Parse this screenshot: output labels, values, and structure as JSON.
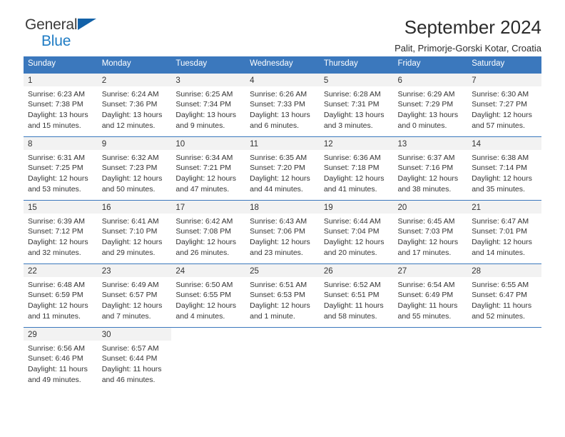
{
  "brand": {
    "word_one": "General",
    "word_two": "Blue",
    "accent_color": "#1261a8",
    "blue_text_color": "#1f7cc4"
  },
  "header": {
    "title": "September 2024",
    "subtitle": "Palit, Primorje-Gorski Kotar, Croatia",
    "header_bg_color": "#3b78bd",
    "daynum_bg_color": "#f2f2f2"
  },
  "weekday_headers": [
    "Sunday",
    "Monday",
    "Tuesday",
    "Wednesday",
    "Thursday",
    "Friday",
    "Saturday"
  ],
  "weeks": [
    [
      {
        "day": "1",
        "sunrise": "Sunrise: 6:23 AM",
        "sunset": "Sunset: 7:38 PM",
        "daylight": "Daylight: 13 hours and 15 minutes."
      },
      {
        "day": "2",
        "sunrise": "Sunrise: 6:24 AM",
        "sunset": "Sunset: 7:36 PM",
        "daylight": "Daylight: 13 hours and 12 minutes."
      },
      {
        "day": "3",
        "sunrise": "Sunrise: 6:25 AM",
        "sunset": "Sunset: 7:34 PM",
        "daylight": "Daylight: 13 hours and 9 minutes."
      },
      {
        "day": "4",
        "sunrise": "Sunrise: 6:26 AM",
        "sunset": "Sunset: 7:33 PM",
        "daylight": "Daylight: 13 hours and 6 minutes."
      },
      {
        "day": "5",
        "sunrise": "Sunrise: 6:28 AM",
        "sunset": "Sunset: 7:31 PM",
        "daylight": "Daylight: 13 hours and 3 minutes."
      },
      {
        "day": "6",
        "sunrise": "Sunrise: 6:29 AM",
        "sunset": "Sunset: 7:29 PM",
        "daylight": "Daylight: 13 hours and 0 minutes."
      },
      {
        "day": "7",
        "sunrise": "Sunrise: 6:30 AM",
        "sunset": "Sunset: 7:27 PM",
        "daylight": "Daylight: 12 hours and 57 minutes."
      }
    ],
    [
      {
        "day": "8",
        "sunrise": "Sunrise: 6:31 AM",
        "sunset": "Sunset: 7:25 PM",
        "daylight": "Daylight: 12 hours and 53 minutes."
      },
      {
        "day": "9",
        "sunrise": "Sunrise: 6:32 AM",
        "sunset": "Sunset: 7:23 PM",
        "daylight": "Daylight: 12 hours and 50 minutes."
      },
      {
        "day": "10",
        "sunrise": "Sunrise: 6:34 AM",
        "sunset": "Sunset: 7:21 PM",
        "daylight": "Daylight: 12 hours and 47 minutes."
      },
      {
        "day": "11",
        "sunrise": "Sunrise: 6:35 AM",
        "sunset": "Sunset: 7:20 PM",
        "daylight": "Daylight: 12 hours and 44 minutes."
      },
      {
        "day": "12",
        "sunrise": "Sunrise: 6:36 AM",
        "sunset": "Sunset: 7:18 PM",
        "daylight": "Daylight: 12 hours and 41 minutes."
      },
      {
        "day": "13",
        "sunrise": "Sunrise: 6:37 AM",
        "sunset": "Sunset: 7:16 PM",
        "daylight": "Daylight: 12 hours and 38 minutes."
      },
      {
        "day": "14",
        "sunrise": "Sunrise: 6:38 AM",
        "sunset": "Sunset: 7:14 PM",
        "daylight": "Daylight: 12 hours and 35 minutes."
      }
    ],
    [
      {
        "day": "15",
        "sunrise": "Sunrise: 6:39 AM",
        "sunset": "Sunset: 7:12 PM",
        "daylight": "Daylight: 12 hours and 32 minutes."
      },
      {
        "day": "16",
        "sunrise": "Sunrise: 6:41 AM",
        "sunset": "Sunset: 7:10 PM",
        "daylight": "Daylight: 12 hours and 29 minutes."
      },
      {
        "day": "17",
        "sunrise": "Sunrise: 6:42 AM",
        "sunset": "Sunset: 7:08 PM",
        "daylight": "Daylight: 12 hours and 26 minutes."
      },
      {
        "day": "18",
        "sunrise": "Sunrise: 6:43 AM",
        "sunset": "Sunset: 7:06 PM",
        "daylight": "Daylight: 12 hours and 23 minutes."
      },
      {
        "day": "19",
        "sunrise": "Sunrise: 6:44 AM",
        "sunset": "Sunset: 7:04 PM",
        "daylight": "Daylight: 12 hours and 20 minutes."
      },
      {
        "day": "20",
        "sunrise": "Sunrise: 6:45 AM",
        "sunset": "Sunset: 7:03 PM",
        "daylight": "Daylight: 12 hours and 17 minutes."
      },
      {
        "day": "21",
        "sunrise": "Sunrise: 6:47 AM",
        "sunset": "Sunset: 7:01 PM",
        "daylight": "Daylight: 12 hours and 14 minutes."
      }
    ],
    [
      {
        "day": "22",
        "sunrise": "Sunrise: 6:48 AM",
        "sunset": "Sunset: 6:59 PM",
        "daylight": "Daylight: 12 hours and 11 minutes."
      },
      {
        "day": "23",
        "sunrise": "Sunrise: 6:49 AM",
        "sunset": "Sunset: 6:57 PM",
        "daylight": "Daylight: 12 hours and 7 minutes."
      },
      {
        "day": "24",
        "sunrise": "Sunrise: 6:50 AM",
        "sunset": "Sunset: 6:55 PM",
        "daylight": "Daylight: 12 hours and 4 minutes."
      },
      {
        "day": "25",
        "sunrise": "Sunrise: 6:51 AM",
        "sunset": "Sunset: 6:53 PM",
        "daylight": "Daylight: 12 hours and 1 minute."
      },
      {
        "day": "26",
        "sunrise": "Sunrise: 6:52 AM",
        "sunset": "Sunset: 6:51 PM",
        "daylight": "Daylight: 11 hours and 58 minutes."
      },
      {
        "day": "27",
        "sunrise": "Sunrise: 6:54 AM",
        "sunset": "Sunset: 6:49 PM",
        "daylight": "Daylight: 11 hours and 55 minutes."
      },
      {
        "day": "28",
        "sunrise": "Sunrise: 6:55 AM",
        "sunset": "Sunset: 6:47 PM",
        "daylight": "Daylight: 11 hours and 52 minutes."
      }
    ],
    [
      {
        "day": "29",
        "sunrise": "Sunrise: 6:56 AM",
        "sunset": "Sunset: 6:46 PM",
        "daylight": "Daylight: 11 hours and 49 minutes."
      },
      {
        "day": "30",
        "sunrise": "Sunrise: 6:57 AM",
        "sunset": "Sunset: 6:44 PM",
        "daylight": "Daylight: 11 hours and 46 minutes."
      },
      {
        "day": "",
        "sunrise": "",
        "sunset": "",
        "daylight": ""
      },
      {
        "day": "",
        "sunrise": "",
        "sunset": "",
        "daylight": ""
      },
      {
        "day": "",
        "sunrise": "",
        "sunset": "",
        "daylight": ""
      },
      {
        "day": "",
        "sunrise": "",
        "sunset": "",
        "daylight": ""
      },
      {
        "day": "",
        "sunrise": "",
        "sunset": "",
        "daylight": ""
      }
    ]
  ]
}
